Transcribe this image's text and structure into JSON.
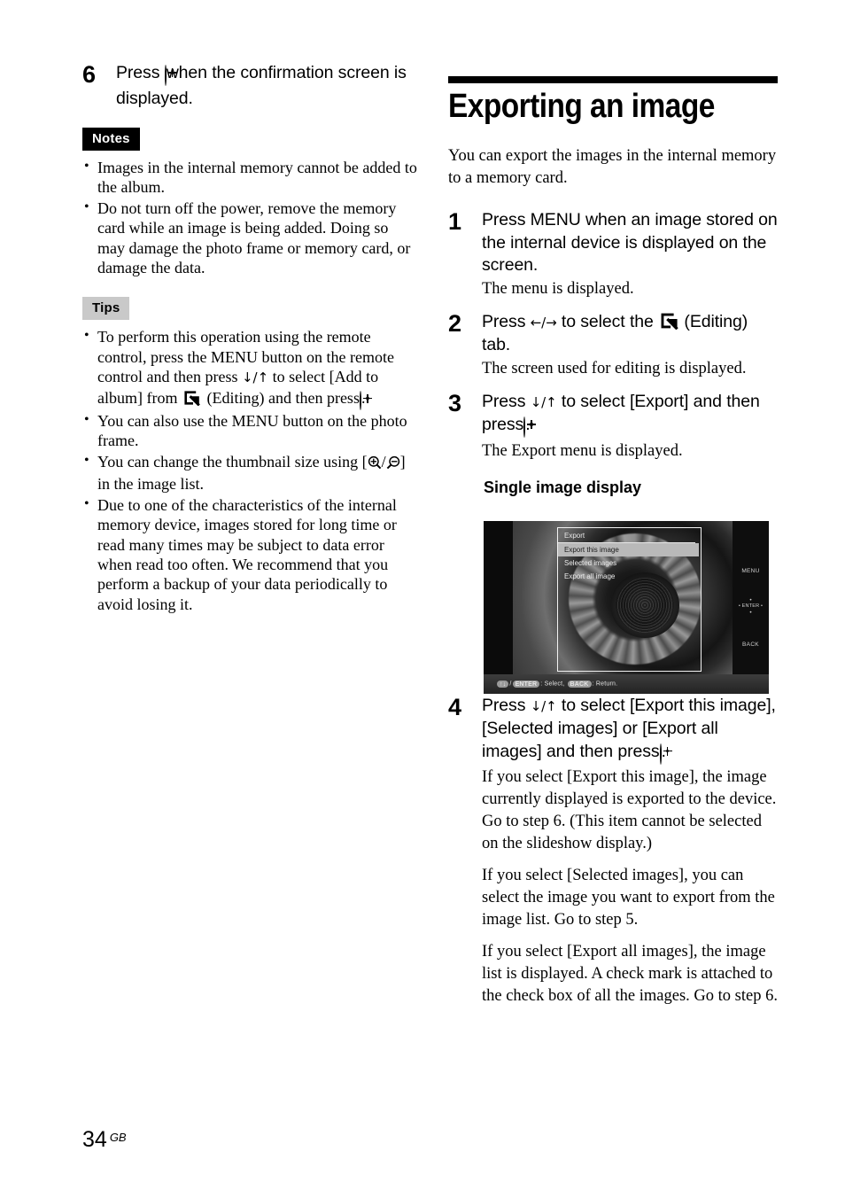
{
  "page": {
    "number": "34",
    "region_code": "GB"
  },
  "left_column": {
    "step6": {
      "number": "6",
      "title_before_icon": "Press",
      "enter_icon": "enter-button-icon",
      "title_after_icon": "when the confirmation screen is displayed."
    },
    "notes": {
      "label": "Notes",
      "items": [
        "Images in the internal memory cannot be added to the album.",
        "Do not turn off the power, remove the memory card while an image is being added. Doing so may damage the photo frame or memory card, or damage the data."
      ]
    },
    "tips": {
      "label": "Tips",
      "items": [
        {
          "part1": "To perform this operation using the remote control, press the MENU button on the remote control and then press",
          "arrows": "↓/↑",
          "part2": "to select [Add to album] from",
          "icon": "editing-tab-icon",
          "part3": "(Editing) and then press",
          "icon2": "enter-button-icon",
          "part4": "."
        },
        {
          "text": "You can also use the MENU button on the photo frame."
        },
        {
          "part1": "You can change the thumbnail size using [",
          "icon": "zoom-in-icon",
          "sep": "/",
          "icon2": "zoom-out-icon",
          "part2": "] in the image list."
        },
        {
          "text": "Due to one of the characteristics of the internal memory device, images stored for long time or read many times may be subject to data error when read too often. We recommend that you perform a backup of your data periodically to avoid losing it."
        }
      ]
    }
  },
  "right_column": {
    "heading": "Exporting an image",
    "intro": "You can export the images in the internal memory to a memory card.",
    "steps": [
      {
        "number": "1",
        "title": "Press MENU when an image stored on the internal device is displayed on the screen.",
        "descriptions": [
          "The menu is displayed."
        ]
      },
      {
        "number": "2",
        "title_part1": "Press",
        "arrows": "←/→",
        "title_part2": "to select the",
        "icon": "editing-tab-icon",
        "title_part3": "(Editing) tab.",
        "descriptions": [
          "The screen used for editing is displayed."
        ]
      },
      {
        "number": "3",
        "title_part1": "Press",
        "arrows": "↓/↑",
        "title_part2": "to select [Export] and then press",
        "icon": "enter-button-icon",
        "title_part3": ".",
        "descriptions": [
          "The Export menu is displayed."
        ]
      },
      {
        "number": "4",
        "title_part1": "Press",
        "arrows": "↓/↑",
        "title_part2": "to select [Export this image], [Selected images] or [Export all images] and then press",
        "icon": "enter-button-icon",
        "title_part3": ".",
        "descriptions": [
          "If you select [Export this image], the image currently displayed is exported to the device. Go to step 6. (This item cannot be selected on the slideshow display.)",
          "If you select [Selected images], you can select the image you want to export from the image list. Go to step 5.",
          "If you select [Export all images], the image list is displayed. A check mark is attached to the check box of all the images. Go to step 6."
        ]
      }
    ],
    "figure": {
      "caption": "Single image display",
      "screen": {
        "menu_title": "Export",
        "menu_items": [
          {
            "label": "Export this image",
            "selected": true
          },
          {
            "label": "Selected images",
            "selected": false
          },
          {
            "label": "Export all image",
            "selected": false
          }
        ],
        "side_buttons": {
          "menu": "MENU",
          "enter": "ENTER",
          "back": "BACK"
        },
        "status_bar": {
          "arrows": "↑↓",
          "sep": "/",
          "enter_key": "ENTER",
          "action1": ": Select,",
          "back_key": "BACK",
          "action2": ": Return."
        }
      }
    }
  }
}
